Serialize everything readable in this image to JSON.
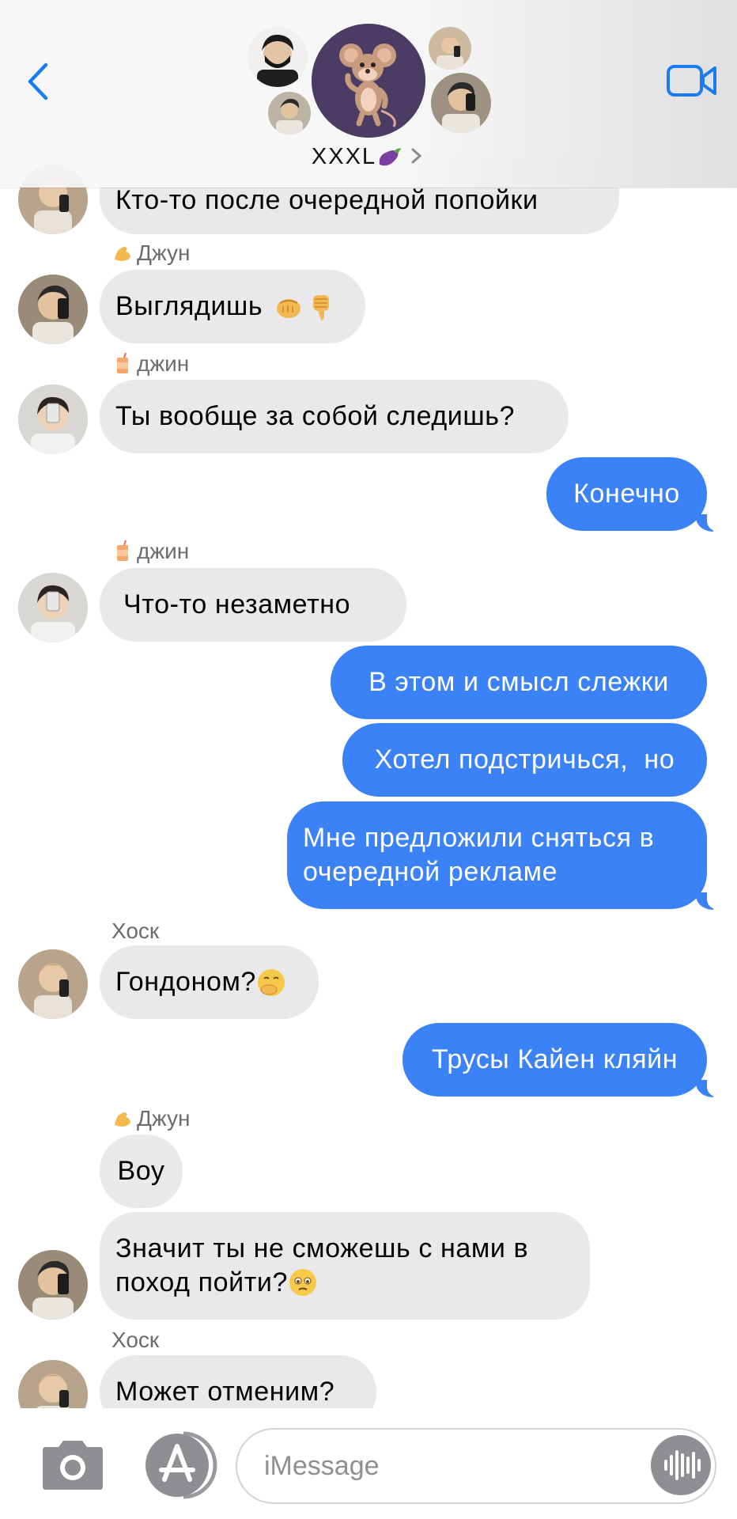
{
  "header": {
    "group_name": "XXXL",
    "group_emoji": "eggplant"
  },
  "messages": [
    {
      "dir": "in",
      "text": "Кто-то после очередной попойки"
    },
    {
      "dir": "in",
      "sender": "Джун",
      "sender_icon": "flexed-biceps",
      "text": "Выглядишь",
      "emojis": [
        "oncoming-fist",
        "thumbs-down"
      ]
    },
    {
      "dir": "in",
      "sender": "джин",
      "sender_icon": "juice-box",
      "text": "Ты вообще за собой следишь?"
    },
    {
      "dir": "out",
      "text": "Конечно"
    },
    {
      "dir": "in",
      "sender": "джин",
      "sender_icon": "juice-box",
      "text": " Что-то незаметно"
    },
    {
      "dir": "out",
      "text": "В этом и смысл слежки"
    },
    {
      "dir": "out",
      "text": "Хотел подстричься,  но"
    },
    {
      "dir": "out",
      "text": "Мне предложили сняться в очередной рекламе"
    },
    {
      "dir": "in",
      "sender": "Хоск",
      "text": "Гондоном?",
      "emojis": [
        "hand-over-mouth"
      ]
    },
    {
      "dir": "out",
      "text": "Трусы Кайен кляйн"
    },
    {
      "dir": "in",
      "sender": "Джун",
      "sender_icon": "flexed-biceps",
      "text": "Воу"
    },
    {
      "dir": "in",
      "text": "Значит ты не сможешь с нами в поход пойти?",
      "emojis": [
        "pleading-face"
      ]
    },
    {
      "dir": "in",
      "sender": "Хоск",
      "text": "Может отменим?"
    }
  ],
  "input": {
    "placeholder": "iMessage"
  },
  "colors": {
    "outgoing_bubble": "#3b82f6",
    "incoming_bubble": "#e9e9eb",
    "accent": "#1a7cf0"
  }
}
